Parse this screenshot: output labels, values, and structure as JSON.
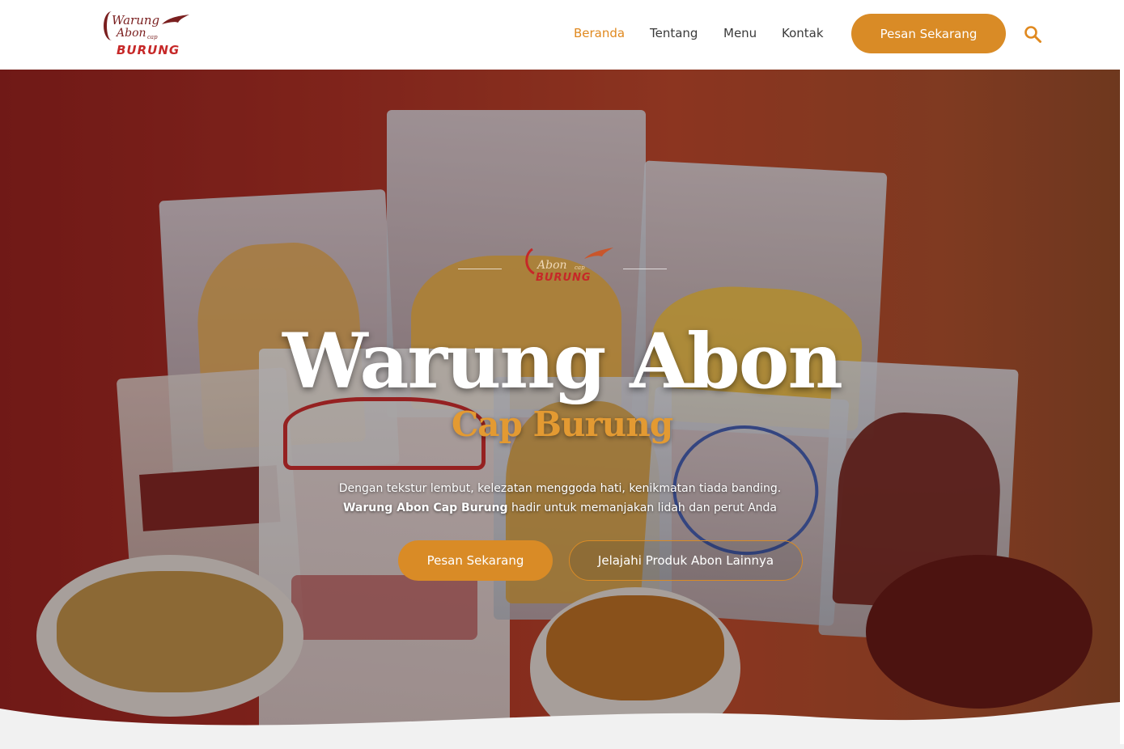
{
  "brand": {
    "logo_line1": "Warung",
    "logo_line2": "Abon",
    "logo_cap": "cap",
    "logo_name": "BURUNG"
  },
  "nav": {
    "items": [
      {
        "label": "Beranda",
        "active": true
      },
      {
        "label": "Tentang",
        "active": false
      },
      {
        "label": "Menu",
        "active": false
      },
      {
        "label": "Kontak",
        "active": false
      }
    ],
    "cta_label": "Pesan Sekarang",
    "search_icon": "search-icon"
  },
  "hero": {
    "emblem_line1": "Abon",
    "emblem_cap": "cap",
    "emblem_name": "BURUNG",
    "title": "Warung Abon",
    "subtitle": "Cap Burung",
    "desc_line1": "Dengan tekstur lembut, kelezatan menggoda hati, kenikmatan tiada banding.",
    "desc_bold": "Warung Abon Cap Burung",
    "desc_line2_rest": " hadir untuk memanjakan lidah dan perut Anda",
    "primary_button": "Pesan Sekarang",
    "secondary_button": "Jelajahi Produk Abon Lainnya"
  },
  "colors": {
    "accent": "#d98b26",
    "active_nav": "#e0891f",
    "brand_red": "#c62828",
    "hero_bg": "#a32d22"
  }
}
